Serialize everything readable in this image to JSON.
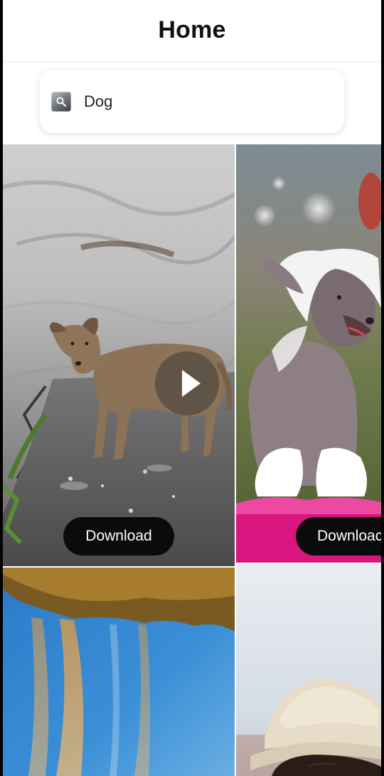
{
  "header": {
    "title": "Home"
  },
  "search": {
    "value": "Dog",
    "icon": "search-icon"
  },
  "feed": {
    "download_label": "Download",
    "download_label_cropped": "Downloac",
    "items": [
      {
        "kind": "video",
        "subject": "stray dog on rock"
      },
      {
        "kind": "image",
        "subject": "chinese crested dog"
      },
      {
        "kind": "image",
        "subject": "waterfall sky"
      },
      {
        "kind": "image",
        "subject": "person in bucket hat"
      }
    ]
  },
  "colors": {
    "background": "#ffffff",
    "button": "#0b0b0b",
    "button_text": "#ffffff",
    "accent_pink": "#d9157f"
  }
}
